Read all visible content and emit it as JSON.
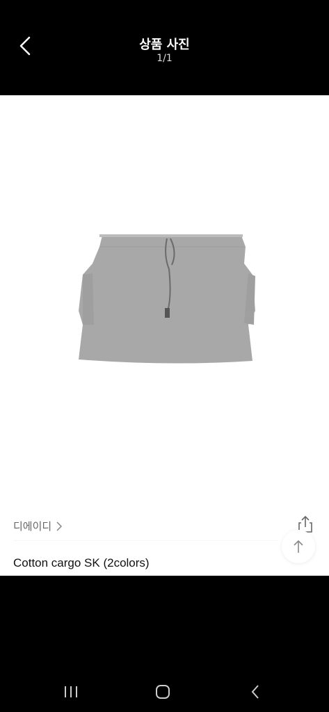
{
  "header": {
    "title": "상품 사진",
    "counter": "1/1"
  },
  "product": {
    "brand": "디에이디",
    "name": "Cotton cargo SK (2colors)"
  },
  "icons": {
    "back": "chevron-left-icon",
    "brand_arrow": "chevron-right-icon",
    "share": "share-icon",
    "scroll_top": "arrow-up-icon",
    "nav_recent": "recent-apps-icon",
    "nav_home": "home-icon",
    "nav_back": "back-icon"
  },
  "colors": {
    "header_bg": "#000000",
    "content_bg": "#ffffff",
    "skirt": "#a8a8a8"
  }
}
